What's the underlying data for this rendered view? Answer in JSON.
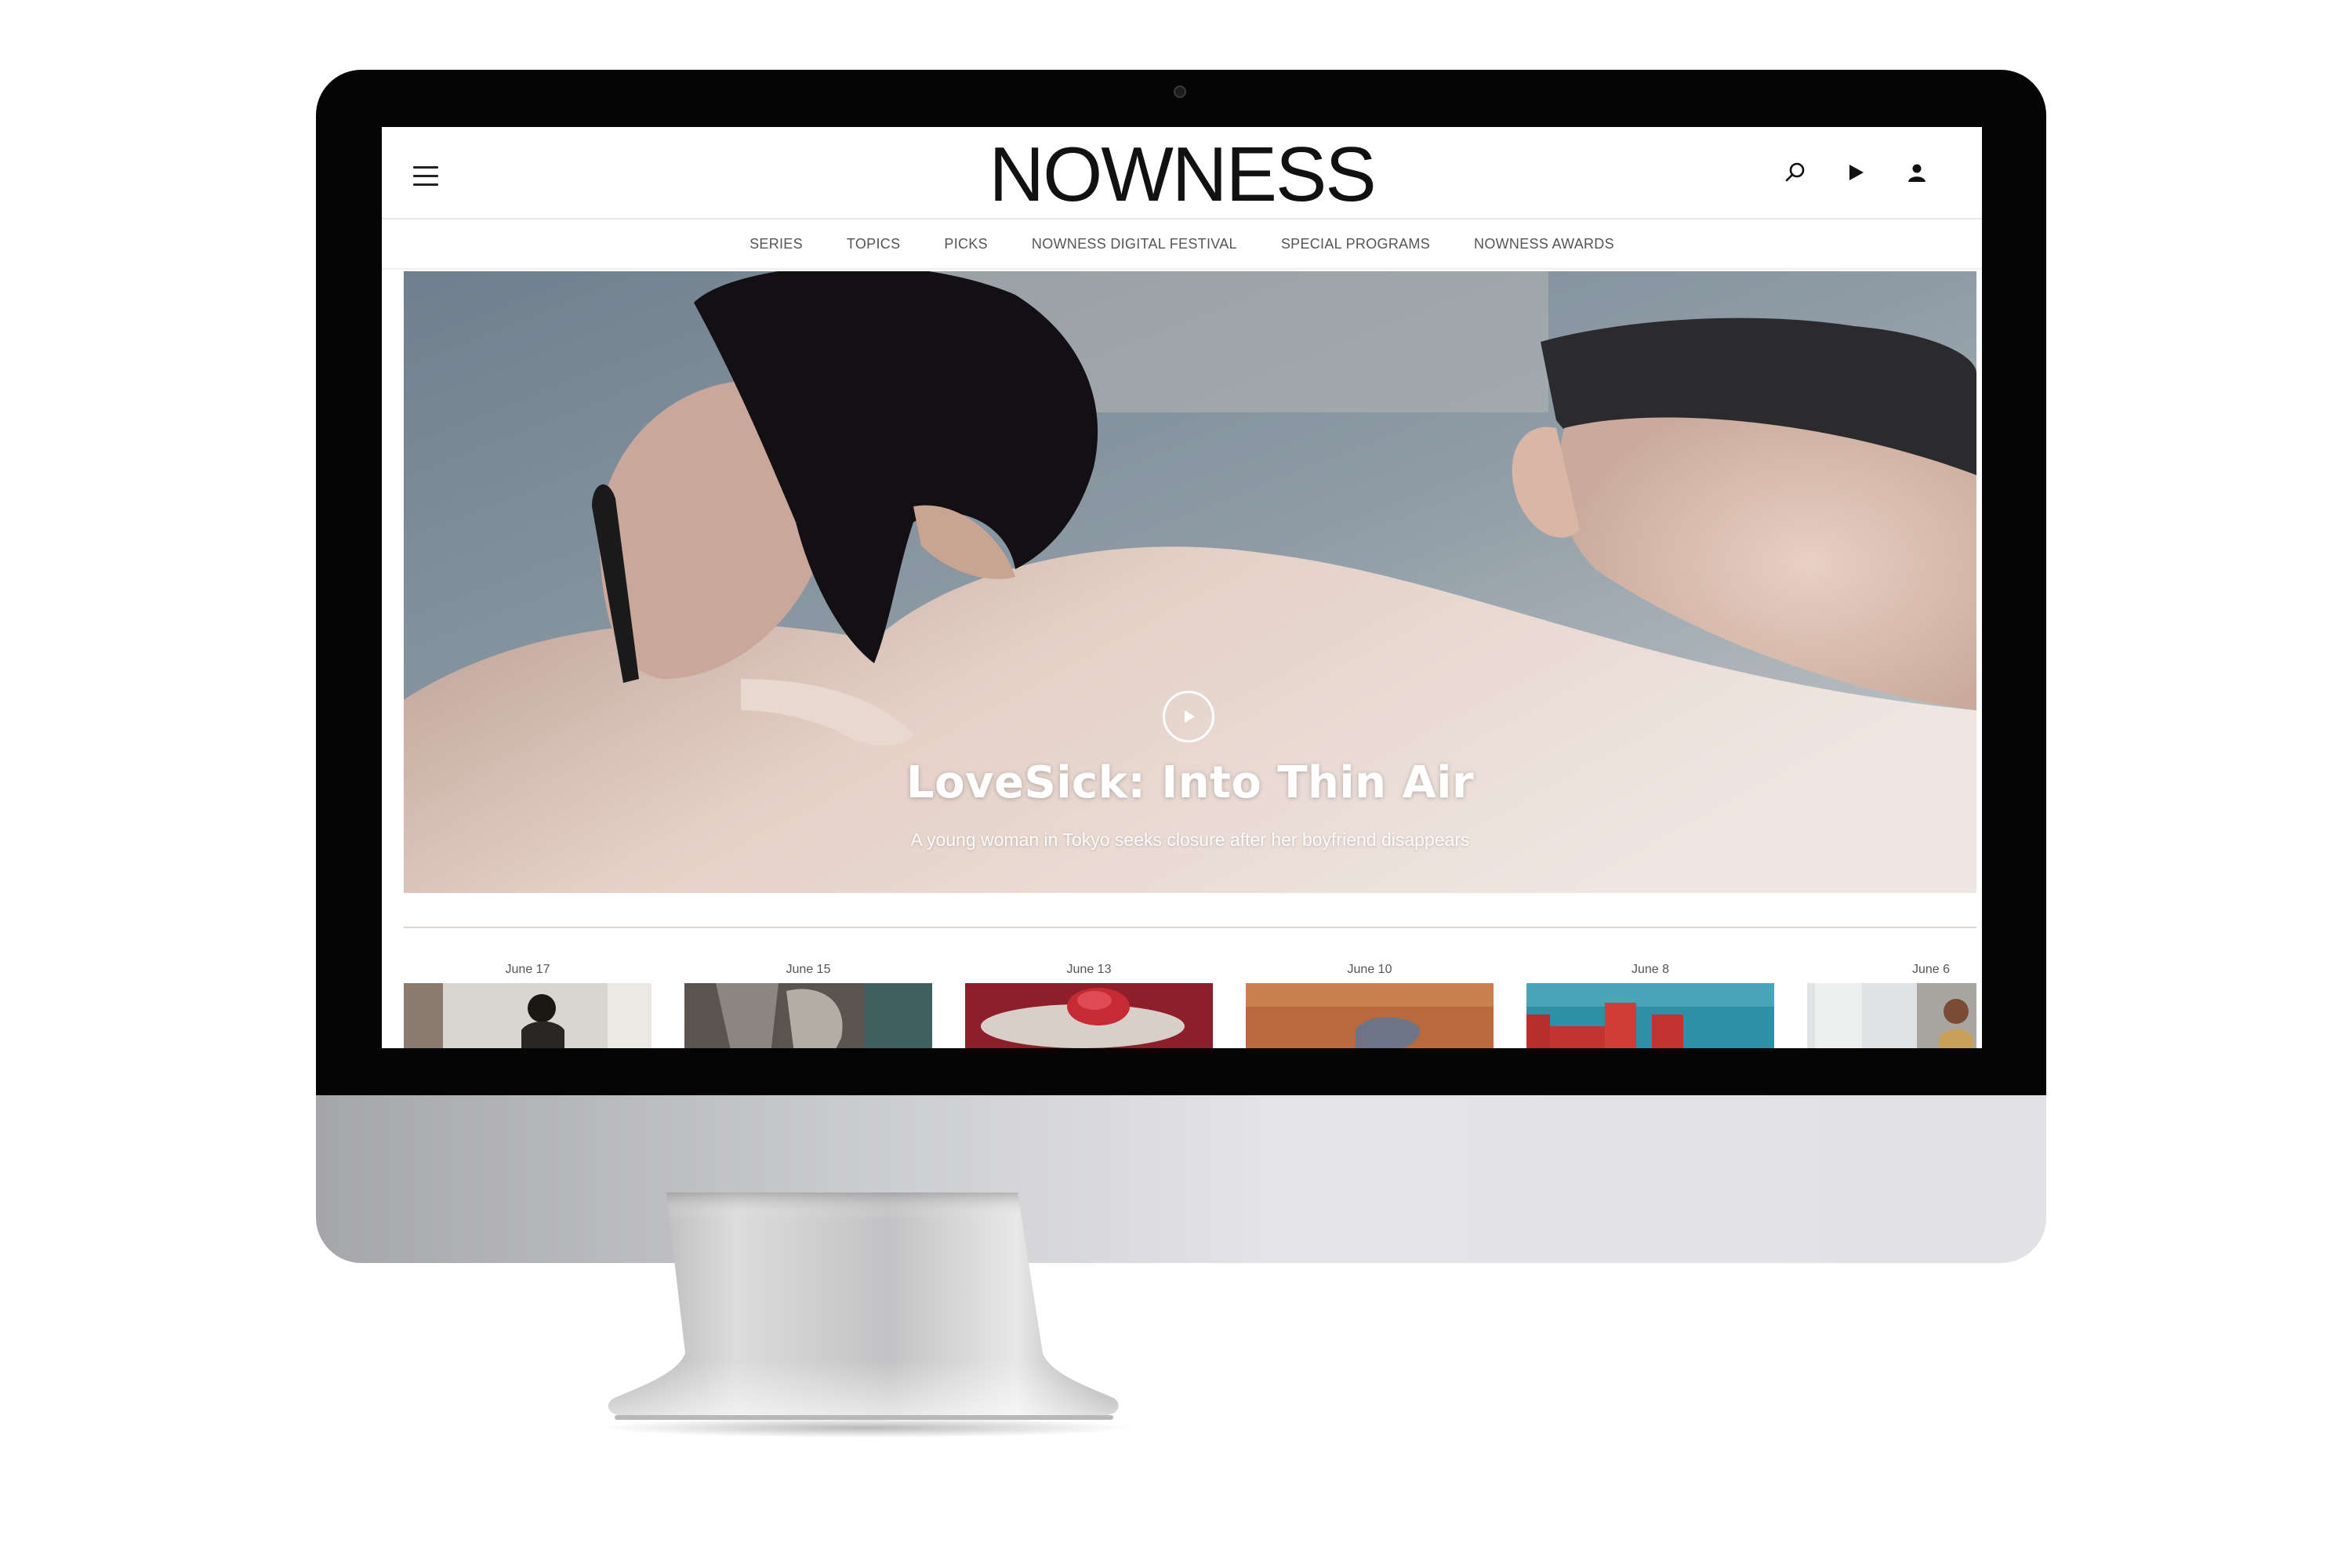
{
  "header": {
    "logo": "NOWNESS"
  },
  "nav": [
    "SERIES",
    "TOPICS",
    "PICKS",
    "NOWNESS DIGITAL FESTIVAL",
    "SPECIAL PROGRAMS",
    "NOWNESS AWARDS"
  ],
  "hero": {
    "title": "LoveSick: Into Thin Air",
    "subtitle": "A young woman in Tokyo seeks closure after her boyfriend disappears"
  },
  "cards": [
    {
      "date": "June 17"
    },
    {
      "date": "June 15"
    },
    {
      "date": "June 13"
    },
    {
      "date": "June 10"
    },
    {
      "date": "June 8"
    },
    {
      "date": "June 6"
    }
  ]
}
